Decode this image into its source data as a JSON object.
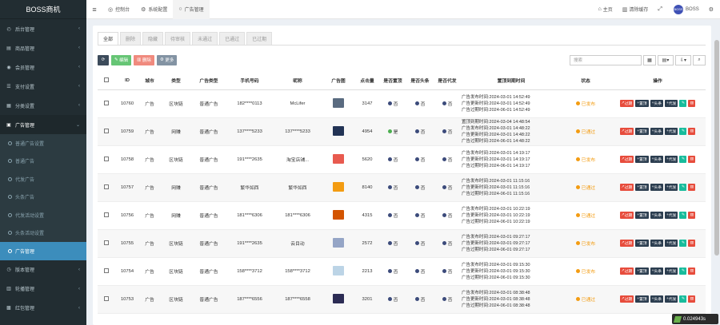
{
  "brand": "BOSS商机",
  "sidebar": {
    "items": [
      {
        "icon": "dashboard-icon",
        "glyph": "◴",
        "label": "后台管理"
      },
      {
        "icon": "shop-icon",
        "glyph": "▤",
        "label": "商品管理"
      },
      {
        "icon": "user-icon",
        "glyph": "◉",
        "label": "会员管理"
      },
      {
        "icon": "list-icon",
        "glyph": "☰",
        "label": "支付设置"
      },
      {
        "icon": "grid-icon",
        "glyph": "▦",
        "label": "分类设置"
      },
      {
        "icon": "ad-icon",
        "glyph": "▣",
        "label": "广告管理"
      }
    ],
    "submenu": [
      "普通广告设置",
      "普通广告",
      "代发广告",
      "头条广告",
      "代发活动设置",
      "头条活动设置",
      "广告管理"
    ],
    "bottom": [
      {
        "icon": "version-icon",
        "glyph": "◷",
        "label": "版本管理"
      },
      {
        "icon": "carousel-icon",
        "glyph": "▥",
        "label": "轮播管理"
      },
      {
        "icon": "redpacket-icon",
        "glyph": "▩",
        "label": "红包管理"
      }
    ]
  },
  "topbar": {
    "tabs": [
      {
        "icon": "dashboard-icon",
        "glyph": "◎",
        "label": "控制台"
      },
      {
        "icon": "gear-icon",
        "glyph": "⚙",
        "label": "系统配置"
      },
      {
        "icon": "circle-icon",
        "glyph": "○",
        "label": "广告管理"
      }
    ],
    "home": "主页",
    "clear_cache": "清除缓存",
    "user": "BOSS"
  },
  "filter_tabs": [
    "全部",
    "删除",
    "隐藏",
    "待审核",
    "未通过",
    "已通过",
    "已过期"
  ],
  "toolbar": {
    "edit": "编辑",
    "delete": "删除",
    "more": "更多",
    "search_placeholder": "搜索"
  },
  "table": {
    "headers": [
      "",
      "ID",
      "城市",
      "类型",
      "广告类型",
      "手机号码",
      "昵称",
      "广告图",
      "点击量",
      "是否置顶",
      "是否头条",
      "是否代发",
      "置顶到期时间",
      "状态",
      "操作"
    ],
    "rows": [
      {
        "id": "10760",
        "city": "广告",
        "cat": "区块链",
        "adtype": "普通广告",
        "phone": "182****0113",
        "nick": "McLifer",
        "thumb": "#5a6b80",
        "clicks": "3147",
        "top": "否",
        "headline": "否",
        "proxy": "否",
        "t1": "广告发布时间:2024-03-01 14:52:49",
        "t2": "广告更新时间:2024-03-01 14:52:49",
        "t3": "广告过期时间:2024-06-01 14:52:49",
        "status": "已发布"
      },
      {
        "id": "10759",
        "city": "广告",
        "cat": "网赚",
        "adtype": "普通广告",
        "phone": "137****5233",
        "nick": "137****5233",
        "thumb": "#223355",
        "clicks": "4954",
        "top": "是",
        "headline": "否",
        "proxy": "否",
        "t1": "置顶到期时间:2024-03-04 14:48:54",
        "t2": "广告发布时间:2024-03-01 14:48:22",
        "t3": "广告更新时间:2024-03-01 14:48:22",
        "t4": "广告过期时间:2024-06-01 14:48:22",
        "status": "已通过"
      },
      {
        "id": "10758",
        "city": "广告",
        "cat": "区块链",
        "adtype": "普通广告",
        "phone": "191****2635",
        "nick": "淘宝店铺...",
        "thumb": "#e85a4f",
        "clicks": "5620",
        "top": "否",
        "headline": "否",
        "proxy": "否",
        "t1": "广告发布时间:2024-03-01 14:19:17",
        "t2": "广告更新时间:2024-03-01 14:19:17",
        "t3": "广告过期时间:2024-06-01 14:19:17",
        "status": "已发布"
      },
      {
        "id": "10757",
        "city": "广告",
        "cat": "网赚",
        "adtype": "普通广告",
        "phone": "繁华如西",
        "nick": "繁华如西",
        "thumb": "#f39c12",
        "clicks": "8140",
        "top": "否",
        "headline": "否",
        "proxy": "否",
        "t1": "广告发布时间:2024-03-01 11:15:16",
        "t2": "广告更新时间:2024-03-01 11:15:16",
        "t3": "广告过期时间:2024-06-01 11:15:16",
        "status": "已通过"
      },
      {
        "id": "10756",
        "city": "广告",
        "cat": "网赚",
        "adtype": "普通广告",
        "phone": "181****6306",
        "nick": "181****6306",
        "thumb": "#d35400",
        "clicks": "4315",
        "top": "否",
        "headline": "否",
        "proxy": "否",
        "t1": "广告发布时间:2024-03-01 10:22:19",
        "t2": "广告更新时间:2024-03-01 10:22:19",
        "t3": "广告过期时间:2024-06-01 10:22:19",
        "status": "已通过"
      },
      {
        "id": "10755",
        "city": "广告",
        "cat": "区块链",
        "adtype": "普通广告",
        "phone": "191****2635",
        "nick": "云目动",
        "thumb": "#95a5c6",
        "clicks": "2572",
        "top": "否",
        "headline": "否",
        "proxy": "否",
        "t1": "广告发布时间:2024-03-01 09:27:17",
        "t2": "广告更新时间:2024-03-01 09:27:17",
        "t3": "广告过期时间:2024-06-01 09:27:17",
        "status": "已发布"
      },
      {
        "id": "10754",
        "city": "广告",
        "cat": "区块链",
        "adtype": "普通广告",
        "phone": "158****3712",
        "nick": "158****3712",
        "thumb": "#bcd4e6",
        "clicks": "2213",
        "top": "否",
        "headline": "否",
        "proxy": "否",
        "t1": "广告发布时间:2024-03-01 09:15:30",
        "t2": "广告更新时间:2024-03-01 09:15:30",
        "t3": "广告过期时间:2024-06-01 09:15:30",
        "status": "已发布"
      },
      {
        "id": "10753",
        "city": "广告",
        "cat": "区块链",
        "adtype": "普通广告",
        "phone": "187****6556",
        "nick": "187****6558",
        "thumb": "#2c2c54",
        "clicks": "3201",
        "top": "否",
        "headline": "否",
        "proxy": "否",
        "t1": "广告发布时间:2024-03-01 08:38:48",
        "t2": "广告更新时间:2024-03-01 08:38:48",
        "t3": "广告过期时间:2024-06-01 08:38:48",
        "status": "已通过"
      }
    ],
    "ops": {
      "expire": "过期",
      "top": "置顶",
      "headline": "头条",
      "proxy": "代发"
    }
  },
  "timer": "0.024943s"
}
